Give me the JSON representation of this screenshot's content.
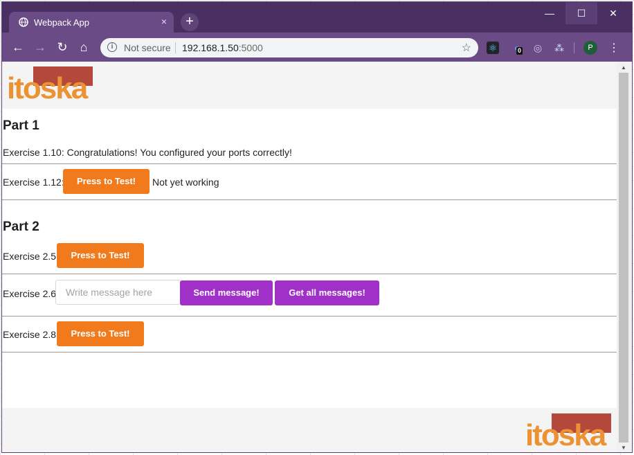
{
  "browser": {
    "tab_title": "Webpack App",
    "tab_close": "×",
    "new_tab": "+",
    "window": {
      "minimize": "—",
      "maximize": "☐",
      "close": "✕"
    },
    "nav": {
      "back": "←",
      "forward": "→",
      "reload": "↻",
      "home": "⌂"
    },
    "omnibox": {
      "info_glyph": "i",
      "security": "Not secure",
      "host": "192.168.1.50",
      "port": ":5000",
      "star": "☆"
    },
    "extensions": [
      {
        "icon": "react-devtools-icon",
        "glyph": "⚛"
      },
      {
        "icon": "extension-badge-icon",
        "glyph": "●",
        "badge": "0"
      },
      {
        "icon": "target-icon",
        "glyph": "◎"
      },
      {
        "icon": "network-icon",
        "glyph": "⁂"
      }
    ],
    "profile_initial": "P",
    "menu": "⋮"
  },
  "page": {
    "logo_text": "itoska",
    "part1": {
      "heading": "Part 1",
      "ex_1_10": "Exercise 1.10: Congratulations! You configured your ports correctly!",
      "ex_1_12_label": "Exercise 1.12:",
      "ex_1_12_button": "Press to Test!",
      "ex_1_12_status": "Not yet working"
    },
    "part2": {
      "heading": "Part 2",
      "ex_2_5_label": "Exercise 2.5:",
      "ex_2_5_button": "Press to Test!",
      "ex_2_6_label": "Exercise 2.6:",
      "ex_2_6_placeholder": "Write message here",
      "ex_2_6_send": "Send message!",
      "ex_2_6_get": "Get all messages!",
      "ex_2_8_label": "Exercise 2.8:",
      "ex_2_8_button": "Press to Test!"
    }
  },
  "colors": {
    "titlebar": "#4a2f63",
    "toolbar": "#6a4b86",
    "orange": "#f17b1c",
    "purple": "#a030c8",
    "logo_red": "#b3483b",
    "logo_orange": "#ec9233"
  },
  "scrollbar": {
    "up": "▲",
    "down": "▼"
  }
}
